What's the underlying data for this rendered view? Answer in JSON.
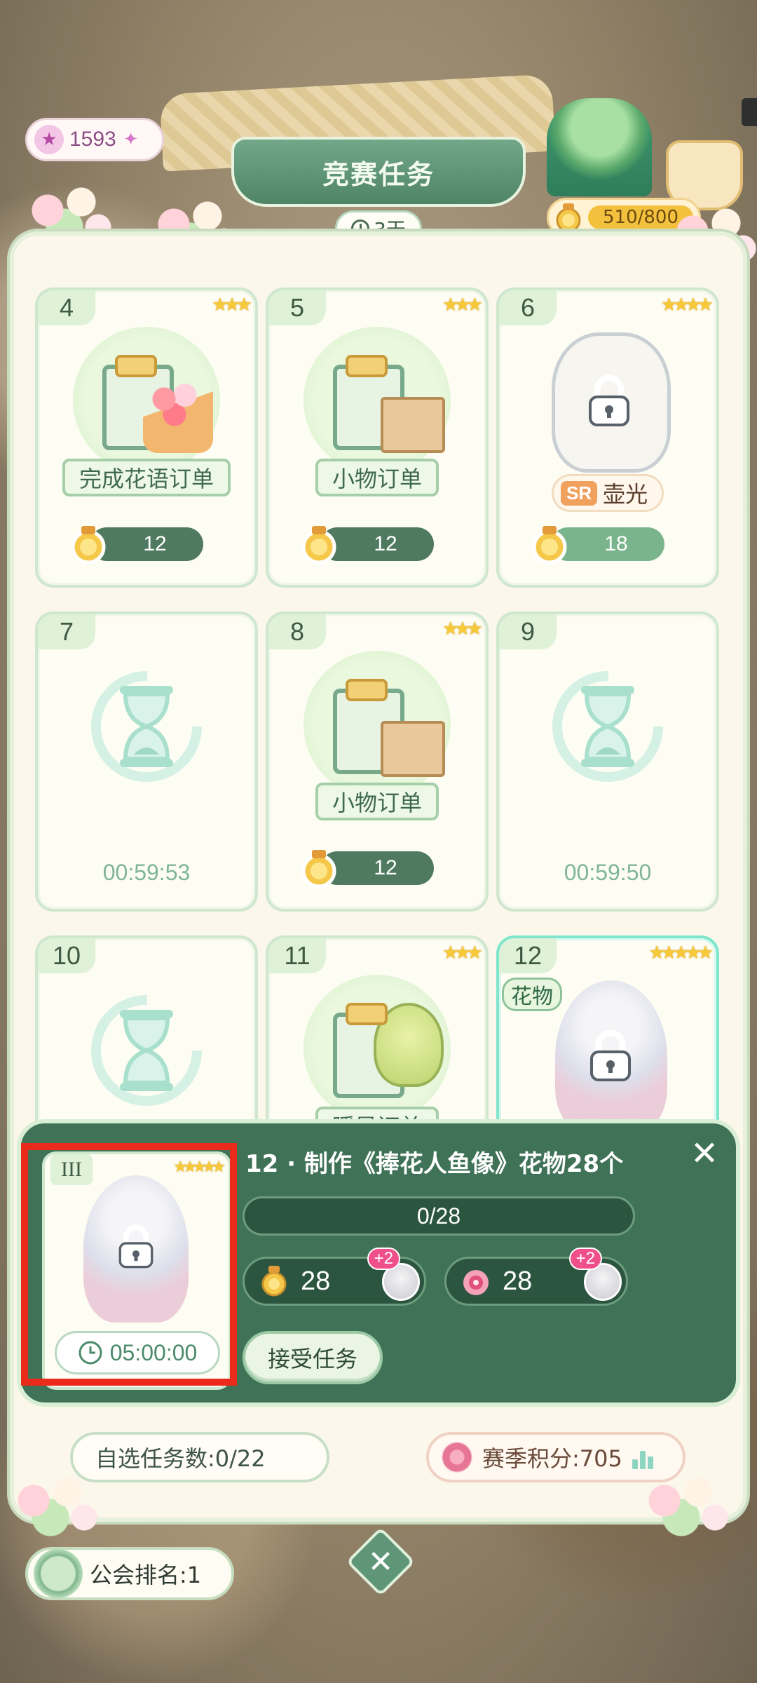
{
  "header": {
    "gems": "1593",
    "title": "竞赛任务",
    "time_left": "3天",
    "medals": "510/800"
  },
  "cards": [
    {
      "num": "4",
      "stars": 3,
      "label": "完成花语订单",
      "reward": "12",
      "kind": "bouquet"
    },
    {
      "num": "5",
      "stars": 3,
      "label": "小物订单",
      "reward": "12",
      "kind": "box"
    },
    {
      "num": "6",
      "stars": 4,
      "label": "壶光",
      "rarity": "SR",
      "reward": "18",
      "kind": "locked-item"
    },
    {
      "num": "7",
      "timer": "00:59:53",
      "kind": "cooldown"
    },
    {
      "num": "8",
      "stars": 3,
      "label": "小物订单",
      "reward": "12",
      "kind": "box"
    },
    {
      "num": "9",
      "timer": "00:59:50",
      "kind": "cooldown"
    },
    {
      "num": "10",
      "kind": "cooldown"
    },
    {
      "num": "11",
      "stars": 3,
      "label": "瞬星订单",
      "kind": "balloon"
    },
    {
      "num": "12",
      "stars": 5,
      "tag": "花物",
      "kind": "locked-flower"
    }
  ],
  "detail": {
    "title": "12 · 制作《捧花人鱼像》花物28个",
    "progress": "0/28",
    "reward_medals": "28",
    "reward_medals_bonus": "+2",
    "reward_points": "28",
    "reward_points_bonus": "+2",
    "accept_label": "接受任务",
    "preview_num": "III",
    "preview_timer": "05:00:00"
  },
  "footer": {
    "self_tasks": "自选任务数:0/22",
    "season_points": "赛季积分:705",
    "guild_rank": "公会排名:1"
  },
  "colors": {
    "panel_green": "#3f7256",
    "highlight_red": "#ea2a1a",
    "star_gold": "#f7c838"
  }
}
